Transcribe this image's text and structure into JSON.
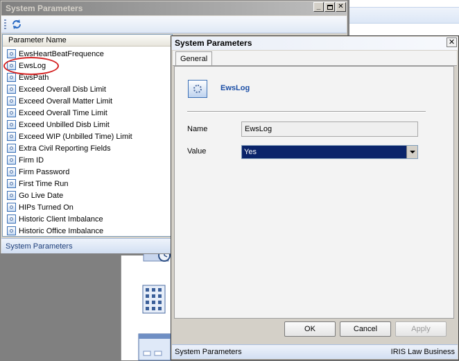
{
  "list_window": {
    "title": "System Parameters",
    "column_header": "Parameter Name",
    "items": [
      "EwsHeartBeatFrequence",
      "EwsLog",
      "EwsPath",
      "Exceed Overall Disb Limit",
      "Exceed Overall Matter Limit",
      "Exceed Overall Time Limit",
      "Exceed Unbilled Disb Limit",
      "Exceed WIP (Unbilled Time) Limit",
      "Extra Civil Reporting Fields",
      "Firm ID",
      "Firm Password",
      "First Time Run",
      "Go Live Date",
      "HIPs Turned On",
      "Historic Client Imbalance",
      "Historic Office Imbalance"
    ],
    "status": "System Parameters"
  },
  "dialog": {
    "title": "System Parameters",
    "tab": "General",
    "header_title": "EwsLog",
    "name_label": "Name",
    "name_value": "EwsLog",
    "value_label": "Value",
    "value_selected": "Yes",
    "ok_label": "OK",
    "cancel_label": "Cancel",
    "apply_label": "Apply",
    "status_left": "System Parameters",
    "status_right": "IRIS Law Business"
  },
  "colors": {
    "accent": "#1b4ea6",
    "selection": "#0a246a",
    "annotation_circle": "#d42020"
  }
}
